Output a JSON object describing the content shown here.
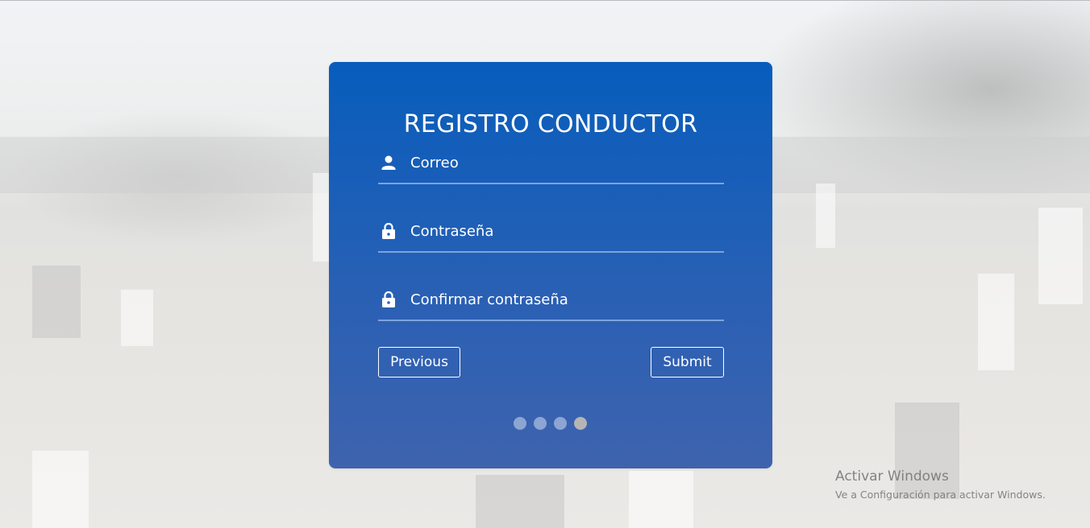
{
  "form": {
    "title": "REGISTRO CONDUCTOR",
    "fields": [
      {
        "icon": "user-icon",
        "placeholder": "Correo",
        "value": ""
      },
      {
        "icon": "lock-icon",
        "placeholder": "Contraseña",
        "value": ""
      },
      {
        "icon": "lock-icon",
        "placeholder": "Confirmar contraseña",
        "value": ""
      }
    ],
    "buttons": {
      "previous": "Previous",
      "submit": "Submit"
    },
    "steps": {
      "total": 4,
      "current": 4
    }
  },
  "watermark": {
    "line1": "Activar Windows",
    "line2": "Ve a Configuración para activar Windows."
  },
  "colors": {
    "card_top": "#075dbc",
    "card_bottom": "#3e63ad",
    "text": "#ffffff",
    "active_step_dot": "#b5b5b5"
  }
}
